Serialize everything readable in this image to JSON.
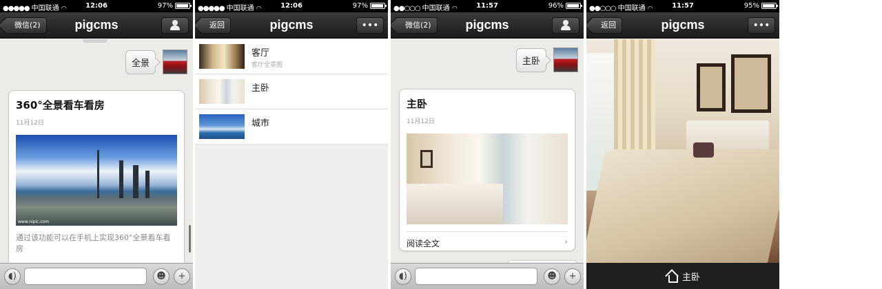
{
  "screens": [
    {
      "status": {
        "carrier": "中国联通",
        "time": "12:06",
        "battery": "97%",
        "battery_level": 0.97
      },
      "nav": {
        "back_label": "微信",
        "back_count": "(2)",
        "title": "pigcms"
      },
      "bubble": "全景",
      "card": {
        "title": "360°全景看车看房",
        "date": "11月12日",
        "desc": "通过该功能可以在手机上实现360°全景看车看房",
        "image_caption": "www.nipic.com"
      }
    },
    {
      "status": {
        "carrier": "中国联通",
        "time": "12:06",
        "battery": "97%",
        "battery_level": 0.97
      },
      "nav": {
        "back_label": "返回",
        "title": "pigcms",
        "more": "•••"
      },
      "list": [
        {
          "title": "客厅",
          "sub": "客厅全景图"
        },
        {
          "title": "主卧",
          "sub": ""
        },
        {
          "title": "城市",
          "sub": ""
        }
      ]
    },
    {
      "status": {
        "carrier": "中国联通",
        "time": "11:57",
        "battery": "96%",
        "battery_level": 0.96
      },
      "nav": {
        "back_label": "微信",
        "back_count": "(2)",
        "title": "pigcms"
      },
      "bubble": "主卧",
      "card": {
        "title": "主卧",
        "date": "11月12日",
        "read_more": "阅读全文"
      }
    },
    {
      "status": {
        "carrier": "中国联通",
        "time": "11:57",
        "battery": "95%",
        "battery_level": 0.95
      },
      "nav": {
        "back_label": "返回",
        "title": "pigcms",
        "more": "•••"
      },
      "bottom_label": "主卧"
    }
  ]
}
